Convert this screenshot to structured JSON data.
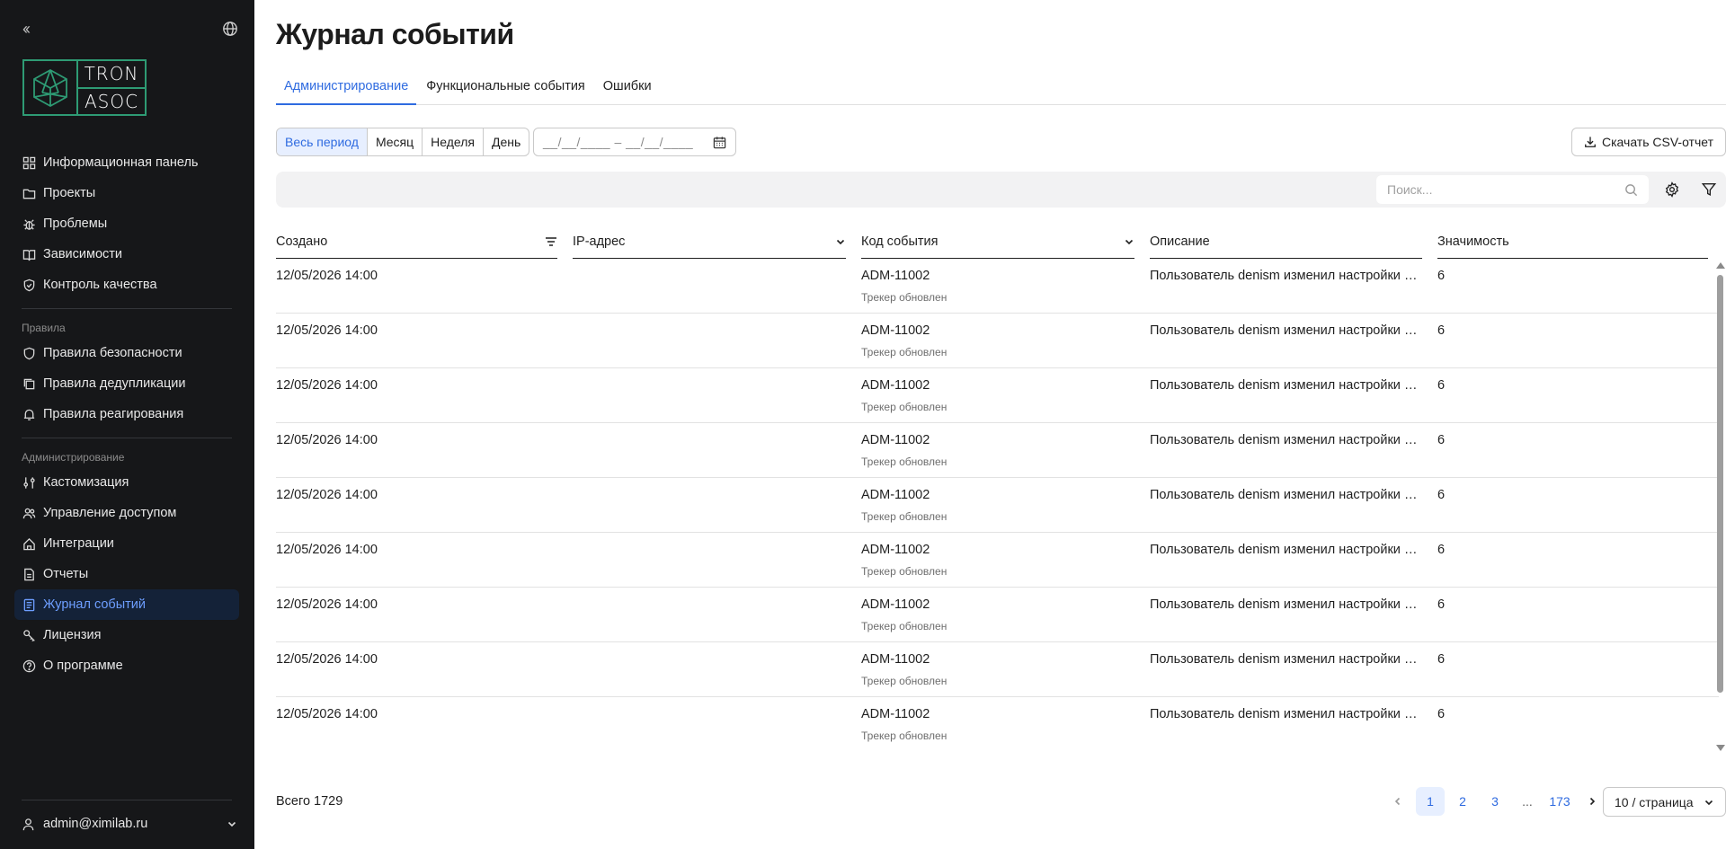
{
  "sidebar": {
    "logo_top": "TRON",
    "logo_bottom": "ASOC",
    "items_main": [
      {
        "label": "Информационная панель",
        "icon": "dashboard-icon"
      },
      {
        "label": "Проекты",
        "icon": "folder-icon"
      },
      {
        "label": "Проблемы",
        "icon": "bug-icon"
      },
      {
        "label": "Зависимости",
        "icon": "book-icon"
      },
      {
        "label": "Контроль качества",
        "icon": "shield-check-icon"
      }
    ],
    "section_rules": "Правила",
    "items_rules": [
      {
        "label": "Правила безопасности",
        "icon": "shield-icon"
      },
      {
        "label": "Правила дедупликации",
        "icon": "copy-icon"
      },
      {
        "label": "Правила реагирования",
        "icon": "bell-icon"
      }
    ],
    "section_admin": "Администрирование",
    "items_admin": [
      {
        "label": "Кастомизация",
        "icon": "sliders-icon"
      },
      {
        "label": "Управление доступом",
        "icon": "users-icon"
      },
      {
        "label": "Интеграции",
        "icon": "plug-icon"
      },
      {
        "label": "Отчеты",
        "icon": "report-icon"
      },
      {
        "label": "Журнал событий",
        "icon": "journal-icon",
        "active": true
      },
      {
        "label": "Лицензия",
        "icon": "key-icon"
      },
      {
        "label": "О программе",
        "icon": "help-icon"
      }
    ],
    "user": "admin@ximilab.ru"
  },
  "page": {
    "title": "Журнал событий",
    "tabs": [
      "Администрирование",
      "Функциональные события",
      "Ошибки"
    ],
    "active_tab": 0,
    "periods": [
      "Весь период",
      "Месяц",
      "Неделя",
      "День"
    ],
    "active_period": 0,
    "date_range": "__/__/____ – __/__/____",
    "csv_button": "Скачать CSV-отчет",
    "search_placeholder": "Поиск..."
  },
  "table": {
    "columns": [
      "Создано",
      "IP-адрес",
      "Код события",
      "Описание",
      "Значимость"
    ],
    "rows": [
      {
        "created": "12/05/2026 14:00",
        "ip": "",
        "code": "ADM-11002",
        "code_sub": "Трекер обновлен",
        "description": "Пользователь denism изменил настройки интеграции",
        "severity": "6"
      },
      {
        "created": "12/05/2026 14:00",
        "ip": "",
        "code": "ADM-11002",
        "code_sub": "Трекер обновлен",
        "description": "Пользователь denism изменил настройки интеграции",
        "severity": "6"
      },
      {
        "created": "12/05/2026 14:00",
        "ip": "",
        "code": "ADM-11002",
        "code_sub": "Трекер обновлен",
        "description": "Пользователь denism изменил настройки интеграции",
        "severity": "6"
      },
      {
        "created": "12/05/2026 14:00",
        "ip": "",
        "code": "ADM-11002",
        "code_sub": "Трекер обновлен",
        "description": "Пользователь denism изменил настройки интеграции",
        "severity": "6"
      },
      {
        "created": "12/05/2026 14:00",
        "ip": "",
        "code": "ADM-11002",
        "code_sub": "Трекер обновлен",
        "description": "Пользователь denism изменил настройки интеграции",
        "severity": "6"
      },
      {
        "created": "12/05/2026 14:00",
        "ip": "",
        "code": "ADM-11002",
        "code_sub": "Трекер обновлен",
        "description": "Пользователь denism изменил настройки интеграции",
        "severity": "6"
      },
      {
        "created": "12/05/2026 14:00",
        "ip": "",
        "code": "ADM-11002",
        "code_sub": "Трекер обновлен",
        "description": "Пользователь denism изменил настройки интеграции",
        "severity": "6"
      },
      {
        "created": "12/05/2026 14:00",
        "ip": "",
        "code": "ADM-11002",
        "code_sub": "Трекер обновлен",
        "description": "Пользователь denism изменил настройки интеграции",
        "severity": "6"
      },
      {
        "created": "12/05/2026 14:00",
        "ip": "",
        "code": "ADM-11002",
        "code_sub": "Трекер обновлен",
        "description": "Пользователь denism изменил настройки интеграции",
        "severity": "6"
      }
    ]
  },
  "footer": {
    "total": "Всего 1729",
    "pages": [
      "1",
      "2",
      "3",
      "...",
      "173"
    ],
    "current_page": "1",
    "per_page": "10 / страница"
  },
  "colors": {
    "accent": "#2f6be0",
    "sidebar_bg": "#161719",
    "brand_green": "#2e9b74",
    "active_bg": "#142238"
  }
}
